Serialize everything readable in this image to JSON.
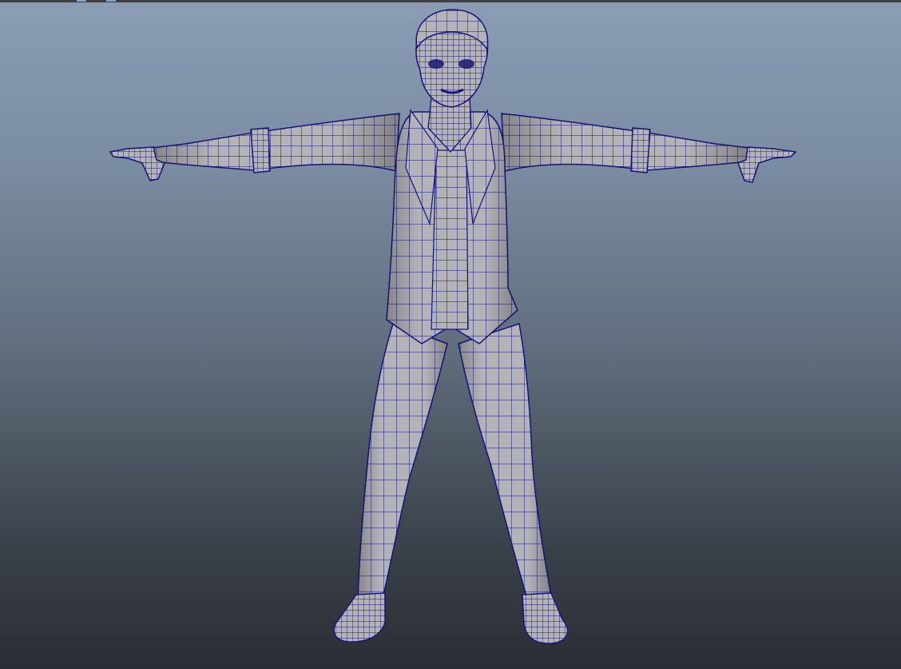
{
  "viewport": {
    "background_top": "#8a9db4",
    "background_bottom": "#2a2e33"
  },
  "model": {
    "surface_color": "#b2b2b6",
    "wire_color": "#14147a",
    "shadow_color": "#7e7e84",
    "pose": "T-pose",
    "display_mode": "wireframe-on-shaded"
  }
}
